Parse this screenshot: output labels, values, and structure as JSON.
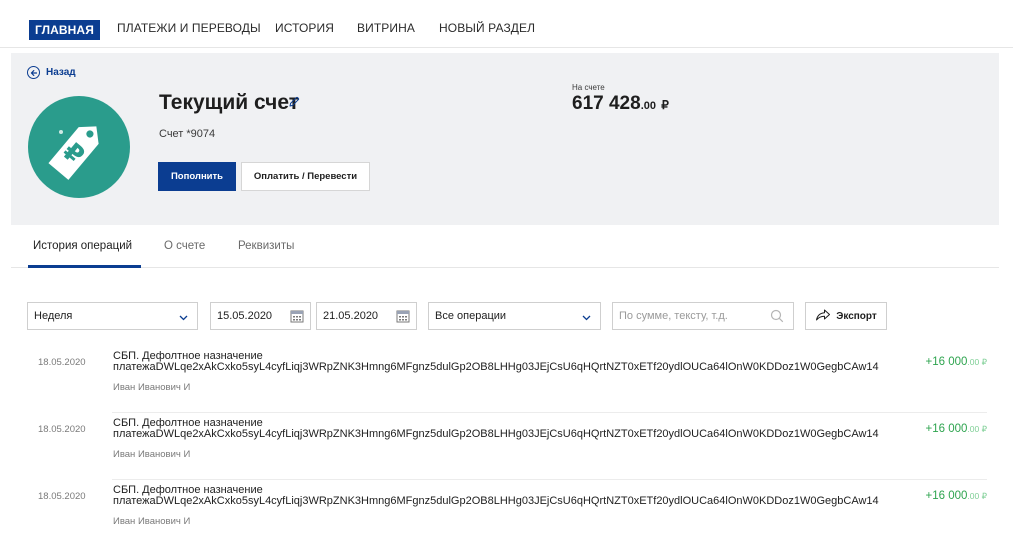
{
  "nav": {
    "items": [
      "ГЛАВНАЯ",
      "ПЛАТЕЖИ И ПЕРЕВОДЫ",
      "ИСТОРИЯ",
      "ВИТРИНА",
      "НОВЫЙ РАЗДЕЛ"
    ],
    "active_index": 0
  },
  "account": {
    "back_label": "Назад",
    "title": "Текущий счет",
    "number": "Счет *9074",
    "deposit_button": "Пополнить",
    "pay_button": "Оплатить / Перевести",
    "balance_label": "На счете",
    "balance_integer": "617 428",
    "balance_fraction": ".00",
    "balance_currency": "₽",
    "avatar_icon": "price-tag-ruble-icon",
    "avatar_color": "#2a9c8c"
  },
  "tabs": [
    "История операций",
    "О счете",
    "Реквизиты"
  ],
  "filters": {
    "period": "Неделя",
    "date_from": "15.05.2020",
    "date_to": "21.05.2020",
    "operation_type": "Все операции",
    "search_placeholder": "По сумме, тексту, т.д.",
    "export_label": "Экспорт"
  },
  "operations": [
    {
      "date": "18.05.2020",
      "description": "СБП. Дефолтное назначение платежаDWLqe2xAkCxko5syL4cyfLiqj3WRpZNK3Hmng6MFgnz5dulGp2OB8LHHg03JEjCsU6qHQrtNZT0xETf20ydlOUCa64lOnW0KDDoz1W0GegbCAw14",
      "counterparty": "Иван Иванович И",
      "amount_integer": "+16 000",
      "amount_fraction": ".00 ₽"
    },
    {
      "date": "18.05.2020",
      "description": "СБП. Дефолтное назначение платежаDWLqe2xAkCxko5syL4cyfLiqj3WRpZNK3Hmng6MFgnz5dulGp2OB8LHHg03JEjCsU6qHQrtNZT0xETf20ydlOUCa64lOnW0KDDoz1W0GegbCAw14",
      "counterparty": "Иван Иванович И",
      "amount_integer": "+16 000",
      "amount_fraction": ".00 ₽"
    },
    {
      "date": "18.05.2020",
      "description": "СБП. Дефолтное назначение платежаDWLqe2xAkCxko5syL4cyfLiqj3WRpZNK3Hmng6MFgnz5dulGp2OB8LHHg03JEjCsU6qHQrtNZT0xETf20ydlOUCa64lOnW0KDDoz1W0GegbCAw14",
      "counterparty": "Иван Иванович И",
      "amount_integer": "+16 000",
      "amount_fraction": ".00 ₽"
    }
  ],
  "colors": {
    "brand": "#0b3d91",
    "positive": "#2ea44f",
    "hero_bg": "#f0f1f3"
  }
}
